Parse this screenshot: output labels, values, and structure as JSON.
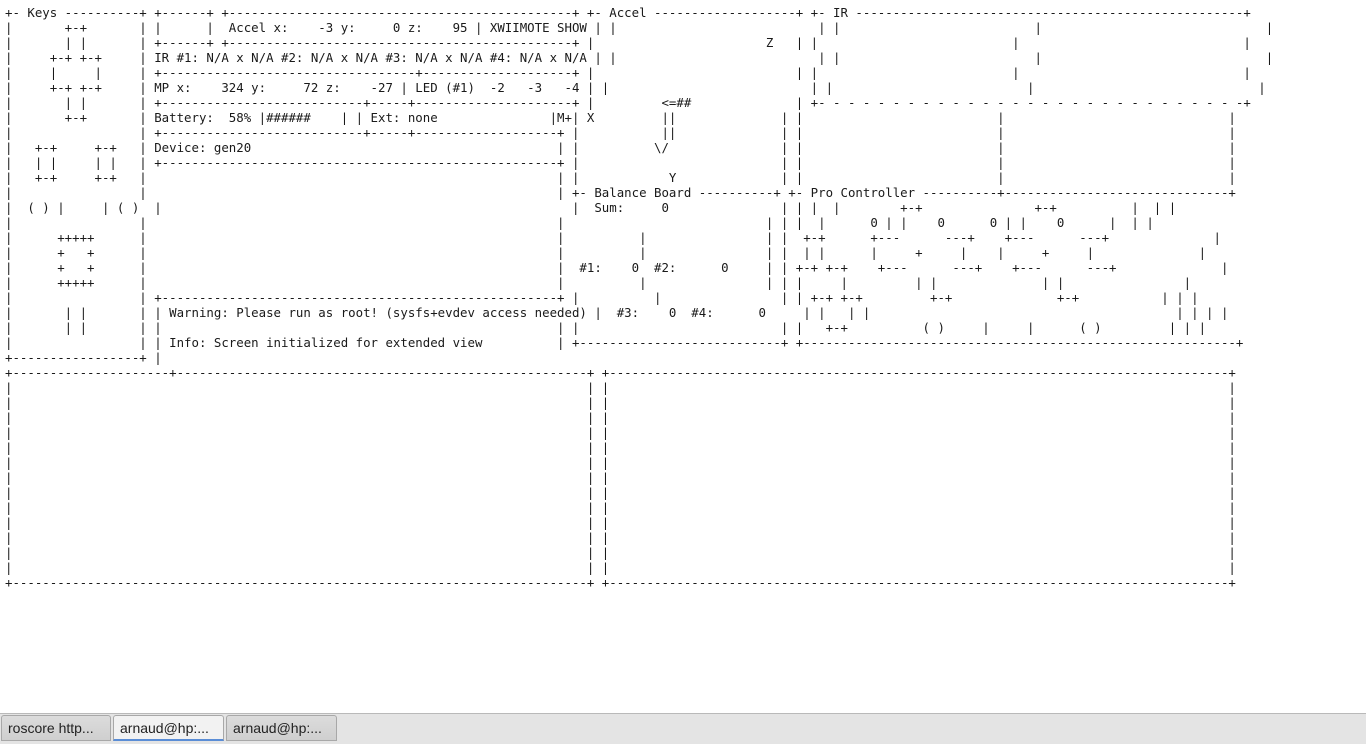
{
  "terminal": {
    "screen_lines": [
      "+- Keys ----------+ +------+ +----------------------------------------------+ +- Accel -------------------+ +- IR ----------------------------------------------------+",
      "|       +-+       | |      |  Accel x:    -3 y:     0 z:    95 | XWIIMOTE SHOW | |                           | |                          |                              |",
      "|       | |       | +------+ +----------------------------------------------+ |                       Z   | |                          |                              |",
      "|     +-+ +-+     | IR #1: N/A x N/A #2: N/A x N/A #3: N/A x N/A #4: N/A x N/A | |                           | |                          |                              |",
      "|     |     |     | +----------------------------------+--------------------+ |                           | |                          |                              |",
      "|     +-+ +-+     | MP x:    324 y:     72 z:    -27 | LED (#1)  -2   -3   -4 | |                           | |                          |                              |",
      "|       | |       | +---------------------------+-----+---------------------+ |         <=##              | +- - - - - - - - - - - - - - - - - - - - - - - - - - - - -+",
      "|       +-+       | Battery:  58% |######    | | Ext: none               |M+| X         ||              | |                          |                              |",
      "|                 | +---------------------------+-----+-------------------+ |           ||              | |                          |                              |",
      "|   +-+     +-+   | Device: gen20                                         | |          \\/               | |                          |                              |",
      "|   | |     | |   | +-----------------------------------------------------+ |                           | |                          |                              |",
      "|   +-+     +-+   |                                                       | |            Y              | |                          |                              |",
      "|                 |                                                       | +- Balance Board ----------+ +- Pro Controller ----------+------------------------------+",
      "|  ( ) |     | ( )  |                                                       |  Sum:     0               | | |  |        +-+               +-+          |  | |",
      "|                 |                                                       |                           | | |  |      0 | |    0      0 | |    0      |  | |",
      "|      +++++      |                                                       |          |                | |  +-+      +---      ---+    +---      ---+              |",
      "|      +   +      |                                                       |          |                | |  | |      |     +     |    |     +     |              |",
      "|      +   +      |                                                       |  #1:    0  #2:      0     | | +-+ +-+    +---      ---+    +---      ---+              |",
      "|      +++++      |                                                       |          |                | | |     |         | |              | |                |",
      "|                 | +-----------------------------------------------------+ |          |                | | +-+ +-+         +-+              +-+           | | |",
      "|       | |       | | Warning: Please run as root! (sysfs+evdev access needed) |  #3:    0  #4:      0     | |   | |                                         | | | |",
      "|       | |       | |                                                     | |                           | |   +-+          ( )     |     |      ( )         | | |",
      "|                 | | Info: Screen initialized for extended view          | +---------------------------+ +----------------------------------------------------------+",
      "+-----------------+ |",
      "+---------------------+-------------------------------------------------------+ +-----------------------------------------------------------------------------------+",
      "|                                                                             | |                                                                                   |",
      "|                                                                             | |                                                                                   |",
      "|                                                                             | |                                                                                   |",
      "|                                                                             | |                                                                                   |",
      "|                                                                             | |                                                                                   |",
      "|                                                                             | |                                                                                   |",
      "|                                                                             | |                                                                                   |",
      "|                                                                             | |                                                                                   |",
      "|                                                                             | |                                                                                   |",
      "|                                                                             | |                                                                                   |",
      "|                                                                             | |                                                                                   |",
      "|                                                                             | |                                                                                   |",
      "|                                                                             | |                                                                                   |",
      "+-----------------------------------------------------------------------------+ +-----------------------------------------------------------------------------------+"
    ]
  },
  "tabs": [
    {
      "label": "roscore http..."
    },
    {
      "label": "arnaud@hp:..."
    },
    {
      "label": "arnaud@hp:..."
    }
  ]
}
